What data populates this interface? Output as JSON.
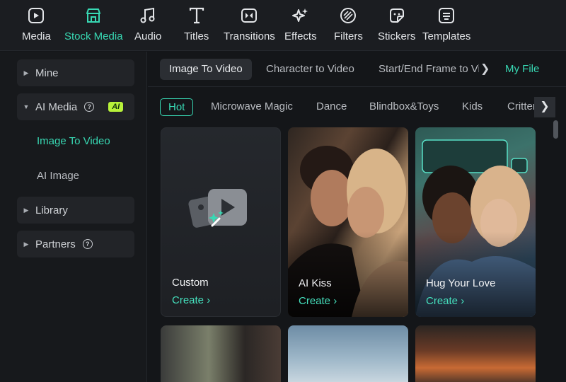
{
  "toolbar": {
    "items": [
      {
        "label": "Media",
        "icon": "media-icon"
      },
      {
        "label": "Stock Media",
        "icon": "store-icon"
      },
      {
        "label": "Audio",
        "icon": "music-note-icon"
      },
      {
        "label": "Titles",
        "icon": "text-icon"
      },
      {
        "label": "Transitions",
        "icon": "transition-icon"
      },
      {
        "label": "Effects",
        "icon": "sparkle-icon"
      },
      {
        "label": "Filters",
        "icon": "filter-icon"
      },
      {
        "label": "Stickers",
        "icon": "sticker-icon"
      },
      {
        "label": "Templates",
        "icon": "template-icon"
      }
    ],
    "active": "Stock Media"
  },
  "sidebar": {
    "mine": "Mine",
    "ai_media": "AI Media",
    "ai_badge": "AI",
    "image_to_video": "Image To Video",
    "ai_image": "AI Image",
    "library": "Library",
    "partners": "Partners"
  },
  "tabs": {
    "image_to_video": "Image To Video",
    "character_to_video": "Character to Video",
    "start_end_frame": "Start/End Frame to Vic",
    "my_file": "My File"
  },
  "chips": {
    "hot": "Hot",
    "microwave_magic": "Microwave Magic",
    "dance": "Dance",
    "blindbox_toys": "Blindbox&Toys",
    "kids": "Kids",
    "critter": "Critter"
  },
  "cards": {
    "custom": {
      "title": "Custom",
      "action": "Create"
    },
    "ai_kiss": {
      "title": "AI Kiss",
      "action": "Create"
    },
    "hug": {
      "title": "Hug Your Love",
      "action": "Create"
    }
  },
  "colors": {
    "accent": "#38d9b4",
    "ai_badge": "#b8f23a",
    "background": "#141619"
  }
}
